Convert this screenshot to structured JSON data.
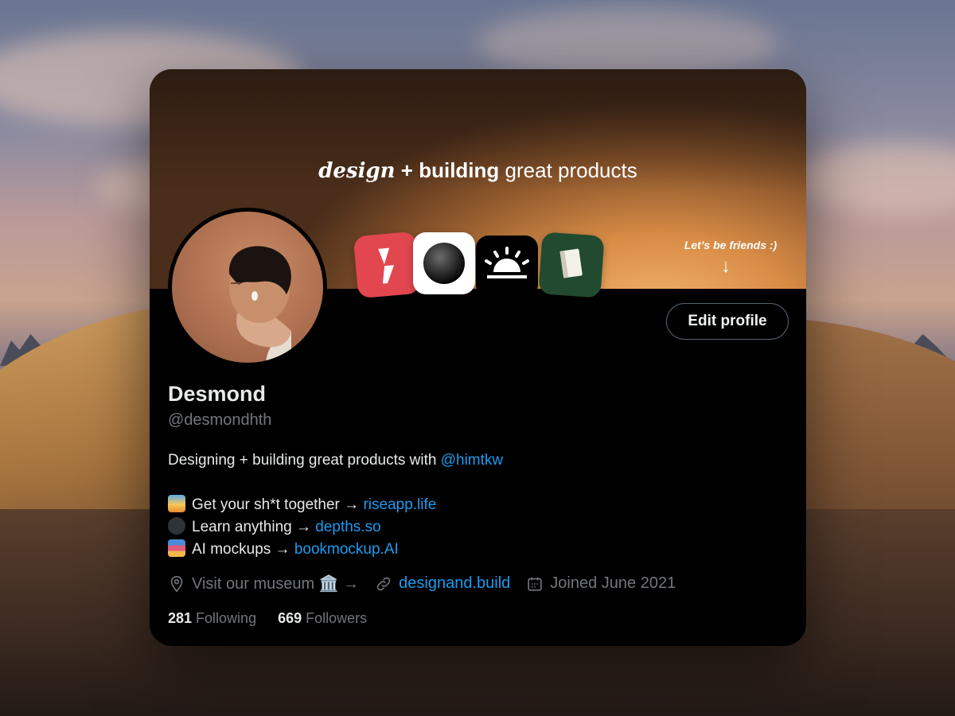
{
  "banner": {
    "headline_italic": "design",
    "headline_plus": " + ",
    "headline_bold": "building",
    "headline_rest": " great products",
    "friends_note": "Let’s be friends :)",
    "arrow": "↓"
  },
  "apps": [
    "rise-app-icon",
    "depths-app-icon",
    "sunrise-app-icon",
    "book-app-icon"
  ],
  "profile": {
    "name": "Desmond",
    "handle": "@desmondhth",
    "edit_label": "Edit profile"
  },
  "bio": {
    "line1_text": "Designing + building great products with ",
    "line1_link": "@himtkw",
    "items": [
      {
        "icon": "sunrise-emoji",
        "text": "Get your sh*t together → ",
        "link": "riseapp.life"
      },
      {
        "icon": "black-circle-emoji",
        "text": "Learn anything → ",
        "link": "depths.so"
      },
      {
        "icon": "books-emoji",
        "text": "AI mockups → ",
        "link": "bookmockup.AI"
      }
    ]
  },
  "meta": {
    "location": "Visit our museum 🏛️ →",
    "website": "designand.build",
    "joined": "Joined June 2021"
  },
  "counts": {
    "following_num": "281",
    "following_label": "Following",
    "followers_num": "669",
    "followers_label": "Followers"
  },
  "colors": {
    "link": "#1d9bf0",
    "text": "#e7e9ea",
    "muted": "#71767b",
    "card_bg": "#000000"
  }
}
